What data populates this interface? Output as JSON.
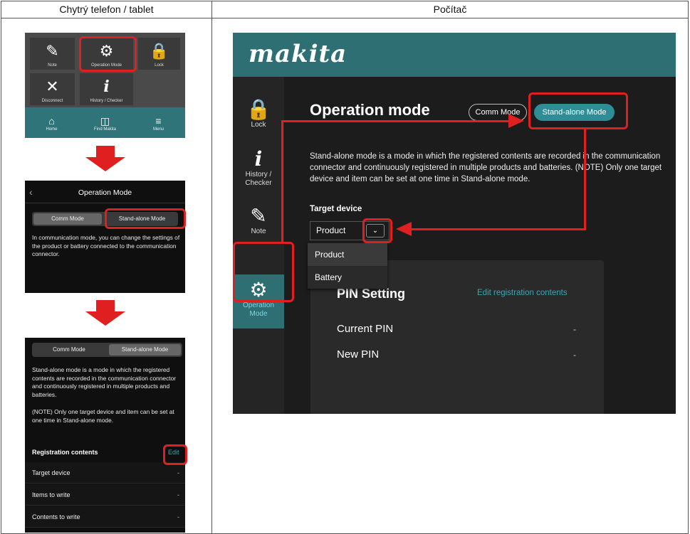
{
  "headers": {
    "left": "Chytrý telefon / tablet",
    "right": "Počítač"
  },
  "phone1": {
    "tiles": [
      {
        "icon": "note-icon",
        "label": "Note"
      },
      {
        "icon": "operation-mode-icon",
        "label": "Operation Mode"
      },
      {
        "icon": "lock-icon",
        "label": "Lock"
      },
      {
        "icon": "disconnect-icon",
        "label": "Disconnect"
      },
      {
        "icon": "info-icon",
        "label": "History / Checker"
      }
    ],
    "tabs": [
      {
        "icon": "home-icon",
        "label": "Home"
      },
      {
        "icon": "find-icon",
        "label": "Find Makita"
      },
      {
        "icon": "menu-icon",
        "label": "Menu"
      }
    ]
  },
  "phone2": {
    "back": "‹",
    "title": "Operation Mode",
    "comm": "Comm Mode",
    "stand": "Stand-alone Mode",
    "text": "In communication mode, you can change the settings of the product or battery connected to the communication connector."
  },
  "phone3": {
    "comm": "Comm Mode",
    "stand": "Stand-alone Mode",
    "text1": "Stand-alone mode is a mode in which the registered contents are recorded in the communication connector and continuously registered in multiple products and batteries.",
    "text2": "(NOTE) Only one target device and item can be set at one time in Stand-alone mode.",
    "reg_title": "Registration contents",
    "edit": "Edit",
    "rows": [
      {
        "label": "Target device",
        "value": "-"
      },
      {
        "label": "Items to write",
        "value": "-"
      },
      {
        "label": "Contents to write",
        "value": "-"
      }
    ]
  },
  "desktop": {
    "brand": "makita",
    "side": [
      {
        "icon": "lock-icon",
        "label": "Lock"
      },
      {
        "icon": "info-icon",
        "label": "History / Checker"
      },
      {
        "icon": "note-icon",
        "label": "Note"
      },
      {
        "icon": "operation-mode-icon",
        "label": "Operation Mode"
      }
    ],
    "title": "Operation mode",
    "comm": "Comm Mode",
    "stand": "Stand-alone Mode",
    "desc": "Stand-alone mode is a mode in which the registered contents are recorded in the communication connector and continuously registered in multiple products and batteries. (NOTE) Only one target device and item can be set at one time in Stand-alone mode.",
    "target_label": "Target device",
    "target_value": "Product",
    "options": [
      "Product",
      "Battery"
    ],
    "card_title": "PIN Setting",
    "card_edit": "Edit registration contents",
    "rows": [
      {
        "label": "Current PIN",
        "value": "-"
      },
      {
        "label": "New PIN",
        "value": "-"
      }
    ]
  },
  "colors": {
    "teal": "#2e6f73",
    "accent": "#2f8d96",
    "highlight": "#e02020"
  }
}
